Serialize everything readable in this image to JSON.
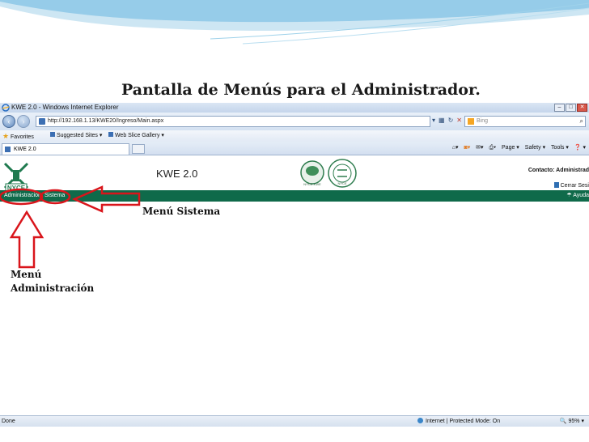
{
  "slide": {
    "title": "Pantalla de Menús para el Administrador."
  },
  "browser": {
    "window_title": "KWE 2.0 - Windows Internet Explorer",
    "url": "http://192.168.1.13/KWE20/Ingreso/Main.aspx",
    "search_placeholder": "Bing",
    "favorites_label": "Favorites",
    "suggested_sites": "Suggested Sites ▾",
    "web_slice_gallery": "Web Slice Gallery ▾",
    "tab_label": "KWE 2.0",
    "commands": {
      "page": "Page ▾",
      "safety": "Safety ▾",
      "tools": "Tools ▾",
      "help": "❓ ▾"
    },
    "status_text": "Done",
    "zone_text": "Internet | Protected Mode: On",
    "zoom_text": "95%"
  },
  "app": {
    "logo_text": "NYCE",
    "name": "KWE 2.0",
    "seal_text": "NYCE-KWE",
    "seal2_text": "NYCE",
    "contact": "Contacto:  Administrad",
    "logout": "Cerrar Sesi",
    "help": "Ayuda",
    "menu_items": [
      "Administración",
      "Sistema"
    ]
  },
  "annotations": {
    "menu_sistema": "Menú Sistema",
    "menu_administracion_line1": "Menú",
    "menu_administracion_line2": "Administración"
  },
  "colors": {
    "menubar": "#0f6a4a",
    "annotation_red": "#d9151b"
  }
}
